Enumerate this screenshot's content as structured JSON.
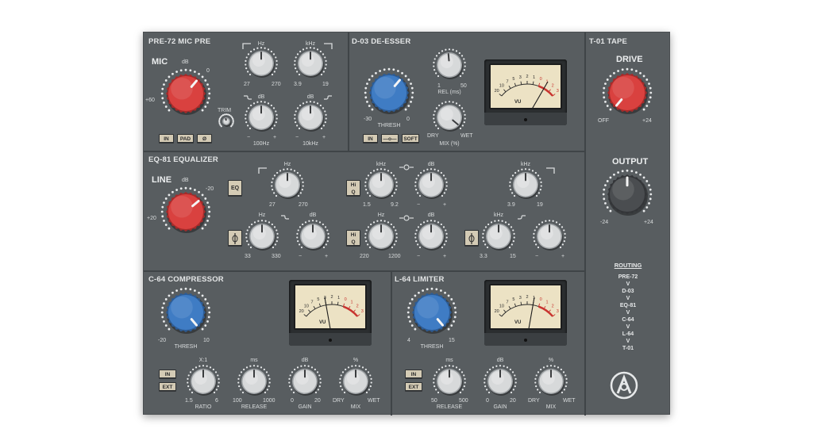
{
  "sections": {
    "pre72": {
      "title": "PRE-72 MIC PRE",
      "mic_label": "MIC",
      "mic_db": "dB",
      "mic_min": "+60",
      "mic_max": "0",
      "trim": "TRIM",
      "hz_label": "Hz",
      "hz_min": "27",
      "hz_max": "270",
      "khz_label": "kHz",
      "khz_min": "3.9",
      "khz_max": "19",
      "db_left": "dB",
      "db_right": "dB",
      "minus": "−",
      "plus": "+",
      "low_shelf_freq": "100Hz",
      "high_shelf_freq": "10kHz",
      "buttons": [
        "IN",
        "PAD",
        "Ø"
      ]
    },
    "d03": {
      "title": "D-03 DE-ESSER",
      "thresh": "THRESH",
      "thresh_min": "-30",
      "thresh_max": "0",
      "rel_label": "REL (ms)",
      "rel_min": "1",
      "rel_max": "50",
      "mix_label": "MIX (%)",
      "dry": "DRY",
      "wet": "WET",
      "buttons": [
        "IN",
        "—o—",
        "SOFT"
      ]
    },
    "t01": {
      "title": "T-01 TAPE",
      "drive": "DRIVE",
      "drive_min": "OFF",
      "drive_max": "+24",
      "output": "OUTPUT",
      "out_min": "-24",
      "out_max": "+24"
    },
    "eq81": {
      "title": "EQ-81 EQUALIZER",
      "line": "LINE",
      "line_db": "dB",
      "line_min": "+20",
      "line_max": "-20",
      "eq_btn": "EQ",
      "hz": "Hz",
      "khz": "kHz",
      "db": "dB",
      "minus": "−",
      "plus": "+",
      "lowcut_min": "27",
      "lowcut_max": "270",
      "hiq": "Hi\nQ",
      "hm_min": "1.5",
      "hm_max": "9.2",
      "hicut_min": "3.9",
      "hicut_max": "19",
      "lows_min": "33",
      "lows_max": "330",
      "lm_min": "220",
      "lm_max": "1200",
      "hs_min": "3.3",
      "hs_max": "15"
    },
    "c64": {
      "title": "C-64 COMPRESSOR",
      "thresh": "THRESH",
      "thresh_min": "-20",
      "thresh_max": "10",
      "ratio_unit": "X:1",
      "ratio": "RATIO",
      "ratio_min": "1.5",
      "ratio_max": "6",
      "ms": "ms",
      "release": "RELEASE",
      "rel_min": "100",
      "rel_max": "1000",
      "db": "dB",
      "gain": "GAIN",
      "gain_min": "0",
      "gain_max": "20",
      "pct": "%",
      "mix": "MIX",
      "dry": "DRY",
      "wet": "WET",
      "in": "IN",
      "ext": "EXT"
    },
    "l64": {
      "title": "L-64 LIMITER",
      "thresh": "THRESH",
      "thresh_min": "4",
      "thresh_max": "15",
      "ms": "ms",
      "release": "RELEASE",
      "rel_min": "50",
      "rel_max": "500",
      "db": "dB",
      "gain": "GAIN",
      "gain_min": "0",
      "gain_max": "20",
      "pct": "%",
      "mix": "MIX",
      "dry": "DRY",
      "wet": "WET",
      "in": "IN",
      "ext": "EXT"
    }
  },
  "routing": {
    "title": "ROUTING",
    "chain": [
      "PRE-72",
      "V",
      "D-03",
      "V",
      "EQ-81",
      "V",
      "C-64",
      "V",
      "L-64",
      "V",
      "T-01"
    ]
  },
  "vu": {
    "scale": [
      "20",
      "10",
      "7",
      "5",
      "3",
      "2",
      "1",
      "0",
      "1",
      "2",
      "3"
    ],
    "label": "VU"
  },
  "colors": {
    "panel": "#585d60",
    "red_knob": "#d9413f",
    "blue_knob": "#3f7cc4",
    "grey_knob": "#d7d9da",
    "dark_knob": "#4a4d50",
    "button": "#d4cbb5",
    "meter_face": "#ece2c4",
    "meter_red": "#c8342f"
  }
}
